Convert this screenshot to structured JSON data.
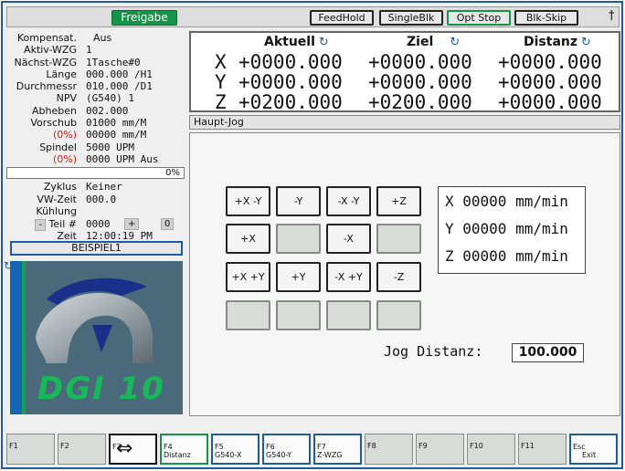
{
  "topbar": {
    "freigabe": "Freigabe",
    "buttons": [
      "FeedHold",
      "SingleBlk",
      "Opt Stop",
      "Blk-Skip"
    ]
  },
  "info": [
    {
      "label": "Kompensat.",
      "value": "Aus"
    },
    {
      "label": "Aktiv-WZG",
      "value": "1"
    },
    {
      "label": "Nächst-WZG",
      "value": "1Tasche#0"
    },
    {
      "label": "Länge",
      "value": "000.000 /H1"
    },
    {
      "label": "Durchmessr",
      "value": "010.000 /D1"
    },
    {
      "label": "NPV",
      "value": "(G540) 1"
    },
    {
      "label": "Abheben",
      "value": "002.000"
    },
    {
      "label": "Vorschub",
      "value": "01000 mm/M"
    },
    {
      "label": "(0%)",
      "value": "00000 mm/M"
    },
    {
      "label": "Spindel",
      "value": "5000 UPM"
    },
    {
      "label": "(0%)",
      "value": "0000 UPM Aus"
    }
  ],
  "progress": {
    "text": "0%",
    "value": 0
  },
  "info2": {
    "zyklus_label": "Zyklus",
    "zyklus_value": "Keiner",
    "vwzeit_label": "VW-Zeit",
    "vwzeit_value": "000.0",
    "kuehlung_label": "Kühlung",
    "teil_label": "Teil #",
    "teil_minus": "-",
    "teil_value": "0000",
    "teil_plus": "+",
    "teil_count": "0",
    "zeit_label": "Zeit",
    "zeit_value": "12:00:19 PM"
  },
  "program": "BEISPIEL1",
  "logo_text": "DGI 10",
  "positions": {
    "headers": [
      "Aktuell",
      "Ziel",
      "Distanz"
    ],
    "rows": [
      {
        "axis": "X",
        "aktuell": "+0000.000",
        "ziel": "+0000.000",
        "distanz": "+0000.000"
      },
      {
        "axis": "Y",
        "aktuell": "+0000.000",
        "ziel": "+0000.000",
        "distanz": "+0000.000"
      },
      {
        "axis": "Z",
        "aktuell": "+0200.000",
        "ziel": "+0200.000",
        "distanz": "+0000.000"
      }
    ]
  },
  "mode": "Haupt-Jog",
  "jog": {
    "buttons": [
      [
        "+X -Y",
        "-Y",
        "-X -Y",
        "+Z"
      ],
      [
        "+X",
        "",
        "-X",
        ""
      ],
      [
        "+X +Y",
        "+Y",
        "-X +Y",
        "-Z"
      ],
      [
        "",
        "",
        "",
        ""
      ]
    ],
    "speeds": [
      "X 00000 mm/min",
      "Y 00000 mm/min",
      "Z 00000 mm/min"
    ],
    "distance_label": "Jog Distanz:",
    "distance_value": "100.000"
  },
  "fkeys": [
    {
      "key": "F1",
      "label": ""
    },
    {
      "key": "F2",
      "label": ""
    },
    {
      "key": "F3",
      "label": ""
    },
    {
      "key": "F4",
      "label": "Distanz"
    },
    {
      "key": "F5",
      "label": "G540-X"
    },
    {
      "key": "F6",
      "label": "G540-Y"
    },
    {
      "key": "F7",
      "label": "Z-WZG"
    },
    {
      "key": "F8",
      "label": ""
    },
    {
      "key": "F9",
      "label": ""
    },
    {
      "key": "F10",
      "label": ""
    },
    {
      "key": "F11",
      "label": ""
    },
    {
      "key": "Esc",
      "label": "Exit"
    }
  ],
  "colors": {
    "accent": "#1f5aa0",
    "green": "#149447",
    "red": "#d02020"
  }
}
